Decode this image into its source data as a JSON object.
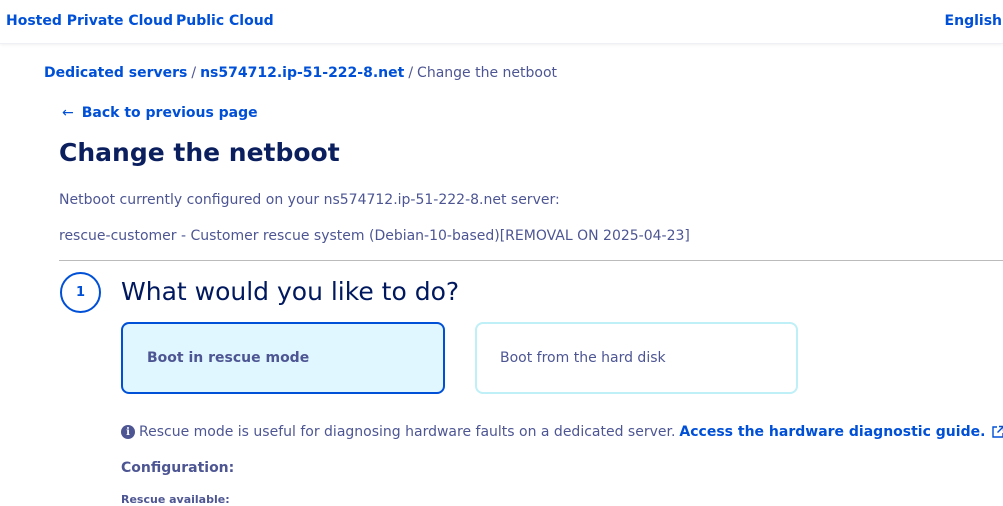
{
  "topbar": {
    "hosted_private_cloud": "Hosted Private Cloud",
    "public_cloud": "Public Cloud",
    "language": "English"
  },
  "breadcrumb": {
    "items": [
      "Dedicated servers",
      "ns574712.ip-51-222-8.net"
    ],
    "current": "Change the netboot",
    "separator": "/"
  },
  "back": {
    "arrow": "←",
    "label": "Back to previous page"
  },
  "page": {
    "title": "Change the netboot",
    "current_label": "Netboot currently configured on your ns574712.ip-51-222-8.net server:",
    "current_value": "rescue-customer - Customer rescue system (Debian-10-based)[REMOVAL ON 2025-04-23]"
  },
  "step": {
    "number": "1",
    "title": "What would you like to do?",
    "options": [
      {
        "label": "Boot in rescue mode",
        "selected": true
      },
      {
        "label": "Boot from the hard disk",
        "selected": false
      }
    ]
  },
  "info": {
    "icon": "info-icon",
    "text": "Rescue mode is useful for diagnosing hardware faults on a dedicated server.",
    "link": "Access the hardware diagnostic guide."
  },
  "configuration": {
    "label": "Configuration:",
    "rescue_available": "Rescue available:"
  },
  "colors": {
    "link": "#0050d7",
    "text": "#4d5693",
    "title": "#0b1f5e",
    "selected_bg": "#e0f7ff",
    "unselected_border": "#bfeff7"
  }
}
